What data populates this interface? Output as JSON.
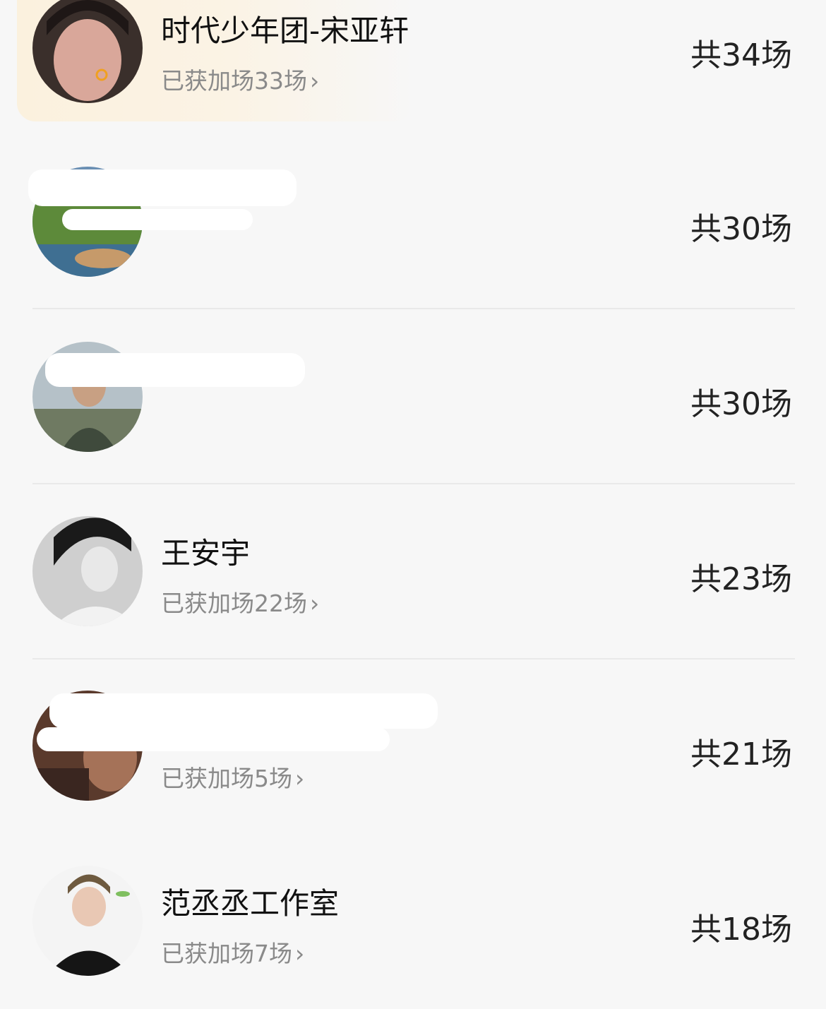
{
  "rows": [
    {
      "name": "时代少年团-宋亚轩",
      "sub": "已获加场33场",
      "count": "共34场",
      "highlighted": true
    },
    {
      "name": "",
      "sub": "",
      "count": "共30场",
      "highlighted": false
    },
    {
      "name": "",
      "sub": "",
      "count": "共30场",
      "highlighted": false
    },
    {
      "name": "王安宇",
      "sub": "已获加场22场",
      "count": "共23场",
      "highlighted": false
    },
    {
      "name": "",
      "sub": "已获加场5场",
      "count": "共21场",
      "highlighted": false
    },
    {
      "name": "范丞丞工作室",
      "sub": "已获加场7场",
      "count": "共18场",
      "highlighted": false
    }
  ],
  "chevron": "›",
  "colors": {
    "highlight": "#fbf1de",
    "divider": "#e9e9e9",
    "subtext": "#8a8a8a",
    "text": "#111111"
  }
}
